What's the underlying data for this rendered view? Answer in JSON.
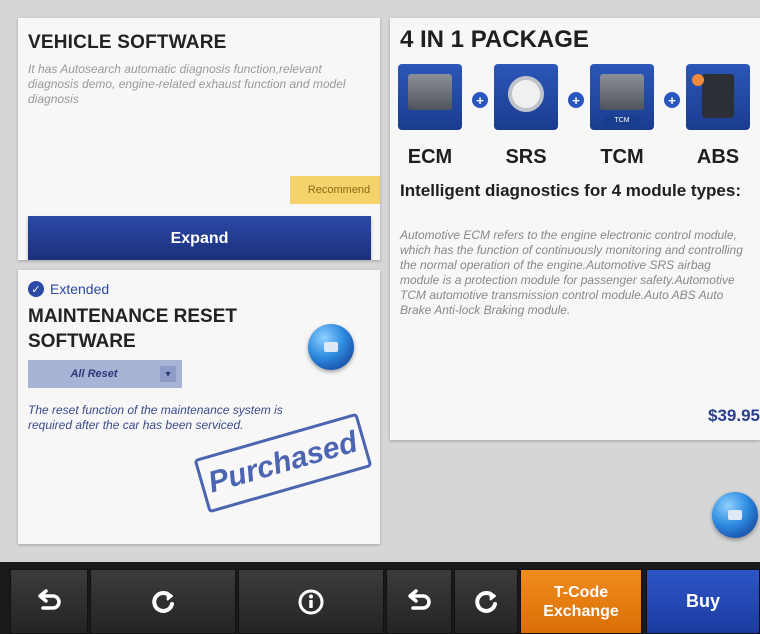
{
  "vehicle_software": {
    "title": "VEHICLE SOFTWARE",
    "description": "It has Autosearch automatic diagnosis function,relevant diagnosis demo, engine-related exhaust function and model diagnosis",
    "badge": "Recommend",
    "expand_label": "Expand"
  },
  "maintenance": {
    "status": "Extended",
    "title": "MAINTENANCE RESET SOFTWARE",
    "select_value": "All Reset",
    "description": "The reset function of the maintenance system is required after the car has been serviced.",
    "stamp": "Purchased"
  },
  "package": {
    "title": "4 IN 1 PACKAGE",
    "modules": [
      {
        "label": "ECM",
        "icon": "ecm-module-icon"
      },
      {
        "label": "SRS",
        "icon": "srs-module-icon"
      },
      {
        "label": "TCM",
        "icon": "tcm-module-icon",
        "tag": "TCM"
      },
      {
        "label": "ABS",
        "icon": "abs-module-icon"
      }
    ],
    "headline": "Intelligent diagnostics for 4 module types:",
    "description": "Automotive ECM refers to the engine electronic control module, which has the function of continuously monitoring and controlling the normal operation of the engine.Automotive SRS airbag module is a protection module for passenger safety.Automotive TCM automotive transmission control module.Auto ABS Auto Brake Anti-lock Braking module.",
    "price": "$39.95"
  },
  "bottom_bar": {
    "tcode_label": "T-Code Exchange",
    "buy_label": "Buy"
  },
  "colors": {
    "accent_blue": "#1b2f7a",
    "badge_yellow": "#f3d36a",
    "tcode_orange": "#f08c20",
    "buy_blue": "#2e56c8"
  }
}
